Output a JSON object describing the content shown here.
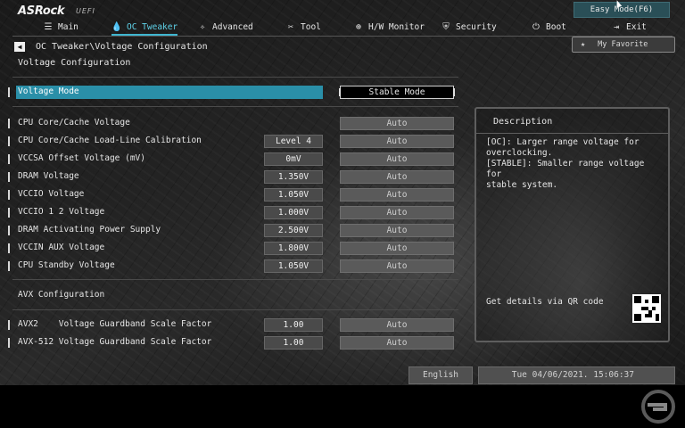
{
  "brand": {
    "logo": "ASRock",
    "logo_sub": "UEFI"
  },
  "header": {
    "easy_mode_label": "Easy Mode(F6)",
    "my_favorite_label": "My Favorite"
  },
  "nav": {
    "tabs": [
      {
        "label": "Main",
        "icon": "list-icon"
      },
      {
        "label": "OC Tweaker",
        "icon": "flame-icon",
        "active": true
      },
      {
        "label": "Advanced",
        "icon": "star-icon"
      },
      {
        "label": "Tool",
        "icon": "tools-icon"
      },
      {
        "label": "H/W Monitor",
        "icon": "globe-icon"
      },
      {
        "label": "Security",
        "icon": "shield-icon"
      },
      {
        "label": "Boot",
        "icon": "power-icon"
      },
      {
        "label": "Exit",
        "icon": "exit-icon"
      }
    ]
  },
  "breadcrumb": "OC Tweaker\\Voltage Configuration",
  "page_title": "Voltage Configuration",
  "settings": {
    "voltage_mode": {
      "label": "Voltage Mode",
      "value": "Stable Mode"
    },
    "rows": [
      {
        "label": "CPU Core/Cache Voltage",
        "current": "",
        "value": "Auto"
      },
      {
        "label": "CPU Core/Cache Load-Line Calibration",
        "current": "Level 4",
        "value": "Auto"
      },
      {
        "label": "VCCSA Offset Voltage (mV)",
        "current": "0mV",
        "value": "Auto"
      },
      {
        "label": "DRAM Voltage",
        "current": "1.350V",
        "value": "Auto"
      },
      {
        "label": "VCCIO Voltage",
        "current": "1.050V",
        "value": "Auto"
      },
      {
        "label": "VCCIO 1 2 Voltage",
        "current": "1.000V",
        "value": "Auto"
      },
      {
        "label": "DRAM Activating Power Supply",
        "current": "2.500V",
        "value": "Auto"
      },
      {
        "label": "VCCIN AUX Voltage",
        "current": "1.800V",
        "value": "Auto"
      },
      {
        "label": "CPU Standby Voltage",
        "current": "1.050V",
        "value": "Auto"
      }
    ]
  },
  "avx": {
    "section_label": "AVX Configuration",
    "rows": [
      {
        "label": "AVX2    Voltage Guardband Scale Factor",
        "current": "1.00",
        "value": "Auto"
      },
      {
        "label": "AVX-512 Voltage Guardband Scale Factor",
        "current": "1.00",
        "value": "Auto"
      }
    ]
  },
  "description": {
    "title": "Description",
    "text": "[OC]: Larger range voltage for\noverclocking.\n[STABLE]: Smaller range voltage for\nstable system.",
    "qr_label": "Get details via QR code"
  },
  "footer": {
    "language": "English",
    "datetime": "Tue 04/06/2021. 15:06:37"
  },
  "colors": {
    "accent": "#3fb6d0",
    "selected_row": "#2a8fa8",
    "easy_mode_bg": "#2a4f57"
  }
}
